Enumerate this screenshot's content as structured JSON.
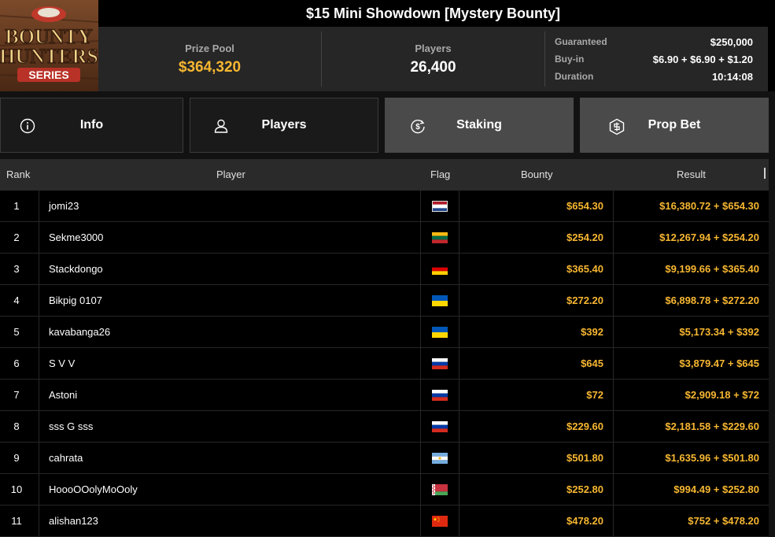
{
  "tournament": {
    "title": "$15 Mini Showdown [Mystery Bounty]",
    "logo_text": "Bounty Hunters Series",
    "prize_pool_label": "Prize Pool",
    "prize_pool": "$364,320",
    "players_label": "Players",
    "players": "26,400",
    "details": [
      {
        "label": "Guaranteed",
        "value": "$250,000"
      },
      {
        "label": "Buy-in",
        "value": "$6.90 + $6.90 + $1.20"
      },
      {
        "label": "Duration",
        "value": "10:14:08"
      }
    ]
  },
  "tabs": [
    {
      "label": "Info",
      "icon": "info-icon"
    },
    {
      "label": "Players",
      "icon": "user-icon"
    },
    {
      "label": "Staking",
      "icon": "dollar-cycle-icon"
    },
    {
      "label": "Prop Bet",
      "icon": "hexagon-dollar-icon"
    }
  ],
  "table": {
    "headers": {
      "rank": "Rank",
      "player": "Player",
      "flag": "Flag",
      "bounty": "Bounty",
      "result": "Result"
    },
    "rows": [
      {
        "rank": "1",
        "player": "jomi23",
        "flag": "Netherlands",
        "bounty": "$654.30",
        "result": "$16,380.72 + $654.30"
      },
      {
        "rank": "2",
        "player": "Sekme3000",
        "flag": "Lithuania",
        "bounty": "$254.20",
        "result": "$12,267.94 + $254.20"
      },
      {
        "rank": "3",
        "player": "Stackdongo",
        "flag": "Germany",
        "bounty": "$365.40",
        "result": "$9,199.66 + $365.40"
      },
      {
        "rank": "4",
        "player": "Bikpig 0107",
        "flag": "Ukraine",
        "bounty": "$272.20",
        "result": "$6,898.78 + $272.20"
      },
      {
        "rank": "5",
        "player": "kavabanga26",
        "flag": "Ukraine",
        "bounty": "$392",
        "result": "$5,173.34 + $392"
      },
      {
        "rank": "6",
        "player": "S V V",
        "flag": "Russia",
        "bounty": "$645",
        "result": "$3,879.47 + $645"
      },
      {
        "rank": "7",
        "player": "Astoni",
        "flag": "Russia",
        "bounty": "$72",
        "result": "$2,909.18 + $72"
      },
      {
        "rank": "8",
        "player": "sss G sss",
        "flag": "Russia",
        "bounty": "$229.60",
        "result": "$2,181.58 + $229.60"
      },
      {
        "rank": "9",
        "player": "cahrata",
        "flag": "Argentina",
        "bounty": "$501.80",
        "result": "$1,635.96 + $501.80"
      },
      {
        "rank": "10",
        "player": "HoooOOolyMoOoly",
        "flag": "Belarus",
        "bounty": "$252.80",
        "result": "$994.49 + $252.80"
      },
      {
        "rank": "11",
        "player": "alishan123",
        "flag": "China",
        "bounty": "$478.20",
        "result": "$752 + $478.20"
      }
    ]
  },
  "colors": {
    "accent": "#f7b731",
    "background": "#000000",
    "header": "#262626",
    "tab_active": "#4a4a4a"
  }
}
